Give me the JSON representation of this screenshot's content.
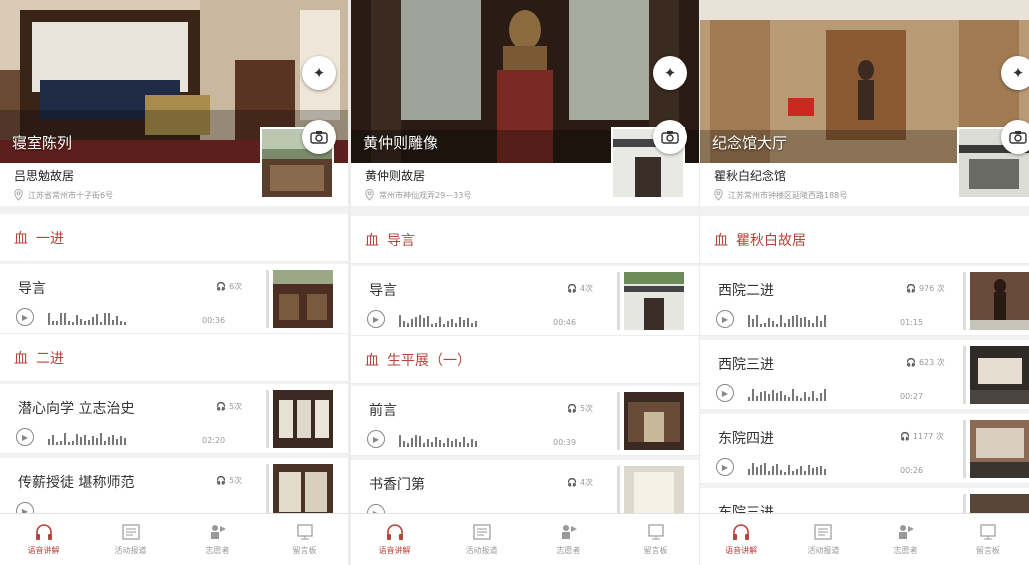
{
  "colors": {
    "accent": "#b5443a",
    "text": "#333333",
    "muted": "#999999"
  },
  "icons": {
    "star": "star-sparkle-icon",
    "camera": "camera-icon",
    "pin": "location-pin-icon",
    "shrine": "shrine-icon",
    "headphones": "headphones-icon",
    "play": "play-icon"
  },
  "tabs": [
    "语音讲解",
    "活动报道",
    "志愿者",
    "留言板"
  ],
  "screens": [
    {
      "hero_title": "寝室陈列",
      "site_name": "吕思勉故居",
      "site_address": "江苏省常州市十子街6号",
      "sections": [
        {
          "title": "一进",
          "items": [
            {
              "title": "导言",
              "listens": "6次",
              "duration": "00:36"
            }
          ]
        },
        {
          "title": "二进",
          "items": [
            {
              "title": "潜心向学 立志治史",
              "listens": "5次",
              "duration": "02:20"
            },
            {
              "title": "传薪授徒 堪称师范",
              "listens": "5次",
              "duration": ""
            }
          ]
        }
      ]
    },
    {
      "hero_title": "黄仲则雕像",
      "site_name": "黄仲则故居",
      "site_address": "常州市神仙观弄29—33号",
      "sections": [
        {
          "title": "导言",
          "items": [
            {
              "title": "导言",
              "listens": "4次",
              "duration": "00:46"
            }
          ]
        },
        {
          "title": "生平展（一）",
          "items": [
            {
              "title": "前言",
              "listens": "5次",
              "duration": "00:39"
            },
            {
              "title": "书香门第",
              "listens": "4次",
              "duration": ""
            }
          ]
        }
      ]
    },
    {
      "hero_title": "纪念馆大厅",
      "site_name": "瞿秋白纪念馆",
      "site_address": "江苏常州市钟楼区延陵西路188号",
      "sections": [
        {
          "title": "瞿秋白故居",
          "items": [
            {
              "title": "西院二进",
              "listens": "976 次",
              "duration": "01:15"
            },
            {
              "title": "西院三进",
              "listens": "623 次",
              "duration": "00:27"
            },
            {
              "title": "东院四进",
              "listens": "1177 次",
              "duration": "00:26"
            },
            {
              "title": "东院三进",
              "listens": "",
              "duration": ""
            }
          ]
        }
      ]
    }
  ]
}
